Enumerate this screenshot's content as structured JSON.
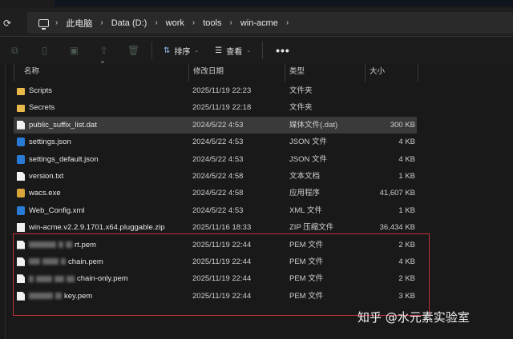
{
  "breadcrumb": [
    "此电脑",
    "Data (D:)",
    "work",
    "tools",
    "win-acme"
  ],
  "toolbar": {
    "sort_label": "排序",
    "view_label": "查看",
    "more_label": "•••"
  },
  "columns": {
    "name": "名称",
    "date": "修改日期",
    "type": "类型",
    "size": "大小"
  },
  "files": [
    {
      "name": "Scripts",
      "date": "2025/11/19 22:23",
      "type": "文件夹",
      "size": "",
      "icon": "folder"
    },
    {
      "name": "Secrets",
      "date": "2025/11/19 22:18",
      "type": "文件夹",
      "size": "",
      "icon": "folder"
    },
    {
      "name": "public_suffix_list.dat",
      "date": "2024/5/22 4:53",
      "type": "媒体文件(.dat)",
      "size": "300 KB",
      "icon": "file",
      "selected": true
    },
    {
      "name": "settings.json",
      "date": "2024/5/22 4:53",
      "type": "JSON 文件",
      "size": "4 KB",
      "icon": "json"
    },
    {
      "name": "settings_default.json",
      "date": "2024/5/22 4:53",
      "type": "JSON 文件",
      "size": "4 KB",
      "icon": "json"
    },
    {
      "name": "version.txt",
      "date": "2024/5/22 4:58",
      "type": "文本文档",
      "size": "1 KB",
      "icon": "file"
    },
    {
      "name": "wacs.exe",
      "date": "2024/5/22 4:58",
      "type": "应用程序",
      "size": "41,607 KB",
      "icon": "exe"
    },
    {
      "name": "Web_Config.xml",
      "date": "2024/5/22 4:53",
      "type": "XML 文件",
      "size": "1 KB",
      "icon": "xml"
    },
    {
      "name": "win-acme.v2.2.9.1701.x64.pluggable.zip",
      "date": "2025/11/16 18:33",
      "type": "ZIP 压缩文件",
      "size": "36,434 KB",
      "icon": "zip"
    },
    {
      "name": "rt.pem",
      "date": "2025/11/19 22:44",
      "type": "PEM 文件",
      "size": "2 KB",
      "icon": "file",
      "blurred": true
    },
    {
      "name": "chain.pem",
      "date": "2025/11/19 22:44",
      "type": "PEM 文件",
      "size": "4 KB",
      "icon": "file",
      "blurred": true
    },
    {
      "name": "chain-only.pem",
      "date": "2025/11/19 22:44",
      "type": "PEM 文件",
      "size": "2 KB",
      "icon": "file",
      "blurred": true
    },
    {
      "name": "key.pem",
      "date": "2025/11/19 22:44",
      "type": "PEM 文件",
      "size": "3 KB",
      "icon": "file",
      "blurred": true
    }
  ],
  "watermark": "知乎 @水元素实验室",
  "colors": {
    "highlight_box": "#c0303a",
    "selection": "#3a3a3a",
    "background": "#191919"
  }
}
